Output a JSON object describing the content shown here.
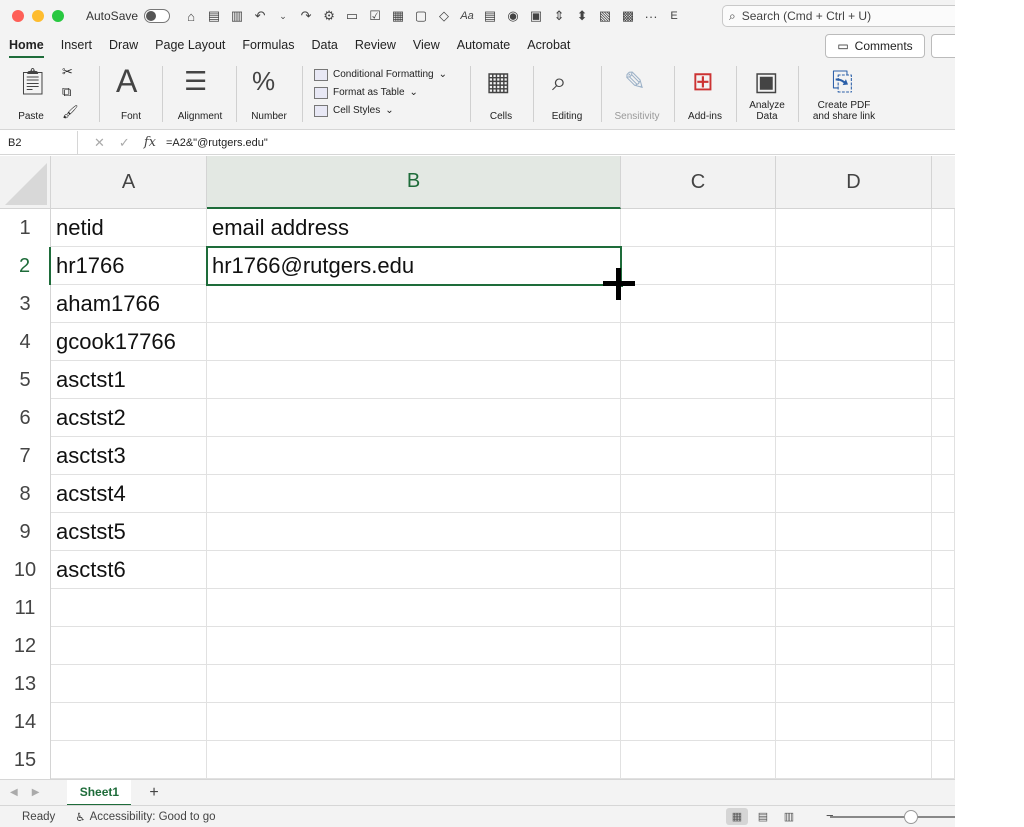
{
  "titlebar": {
    "autosave_label": "AutoSave",
    "truncated_title": "E",
    "more": "···",
    "search_placeholder": "Search (Cmd + Ctrl + U)"
  },
  "tabs": [
    "Home",
    "Insert",
    "Draw",
    "Page Layout",
    "Formulas",
    "Data",
    "Review",
    "View",
    "Automate",
    "Acrobat"
  ],
  "comments_label": "Comments",
  "ribbon": {
    "paste": "Paste",
    "font": "Font",
    "alignment": "Alignment",
    "number": "Number",
    "conditional_formatting": "Conditional Formatting",
    "format_as_table": "Format as Table",
    "cell_styles": "Cell Styles",
    "cells": "Cells",
    "editing": "Editing",
    "sensitivity": "Sensitivity",
    "add_ins": "Add-ins",
    "analyze_data_1": "Analyze",
    "analyze_data_2": "Data",
    "create_pdf_1": "Create PDF",
    "create_pdf_2": "and share link"
  },
  "formula_bar": {
    "name_box": "B2",
    "fx": "fx",
    "formula": "=A2&\"@rutgers.edu\""
  },
  "columns": [
    "A",
    "B",
    "C",
    "D"
  ],
  "rows": [
    {
      "num": "1",
      "a": "netid",
      "b": "email address"
    },
    {
      "num": "2",
      "a": "hr1766",
      "b": "hr1766@rutgers.edu"
    },
    {
      "num": "3",
      "a": "aham1766",
      "b": ""
    },
    {
      "num": "4",
      "a": "gcook17766",
      "b": ""
    },
    {
      "num": "5",
      "a": "asctst1",
      "b": ""
    },
    {
      "num": "6",
      "a": "acstst2",
      "b": ""
    },
    {
      "num": "7",
      "a": "asctst3",
      "b": ""
    },
    {
      "num": "8",
      "a": "acstst4",
      "b": ""
    },
    {
      "num": "9",
      "a": "acstst5",
      "b": ""
    },
    {
      "num": "10",
      "a": "asctst6",
      "b": ""
    },
    {
      "num": "11",
      "a": "",
      "b": ""
    },
    {
      "num": "12",
      "a": "",
      "b": ""
    },
    {
      "num": "13",
      "a": "",
      "b": ""
    },
    {
      "num": "14",
      "a": "",
      "b": ""
    },
    {
      "num": "15",
      "a": "",
      "b": ""
    }
  ],
  "sheets": [
    "Sheet1"
  ],
  "add_sheet": "+",
  "status": {
    "ready": "Ready",
    "accessibility": "Accessibility: Good to go",
    "zoom_minus": "−"
  },
  "colors": {
    "accent": "#1e6c3a"
  }
}
